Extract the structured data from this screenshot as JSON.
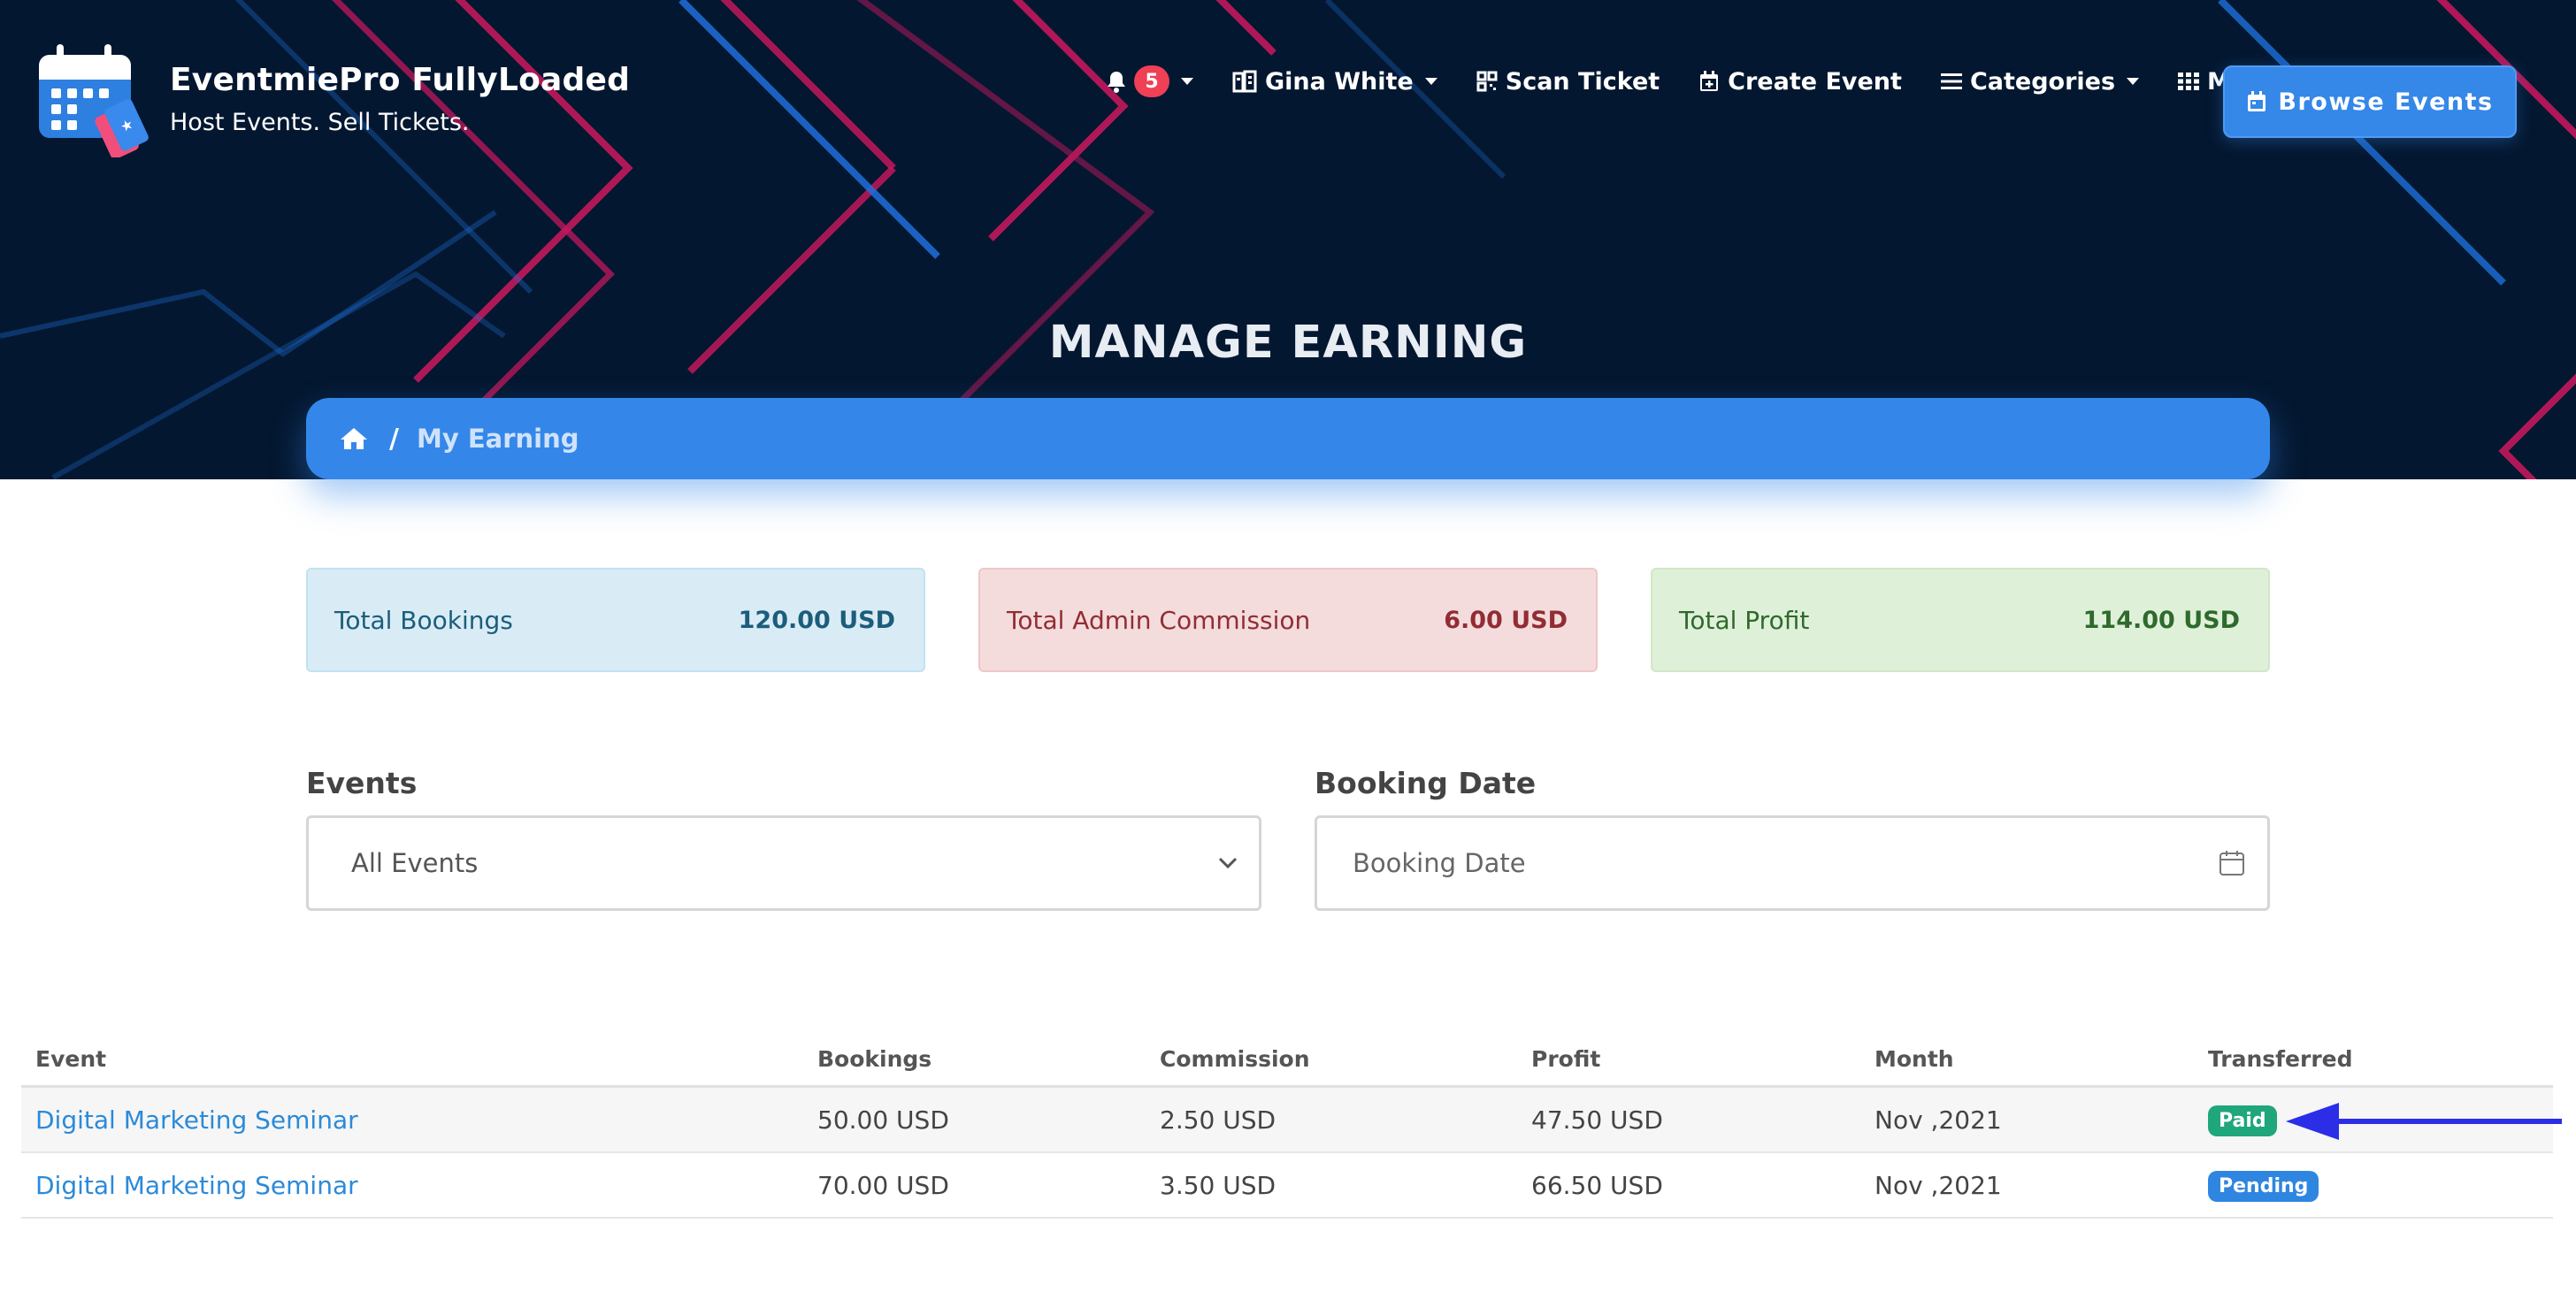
{
  "brand": {
    "name": "EventmiePro FullyLoaded",
    "tagline": "Host Events. Sell Tickets."
  },
  "nav": {
    "notifications_count": "5",
    "user_name": "Gina White",
    "scan_ticket": "Scan Ticket",
    "create_event": "Create Event",
    "categories": "Categories",
    "more": "More",
    "browse_events": "Browse Events"
  },
  "page": {
    "title": "MANAGE EARNING",
    "breadcrumb_current": "My Earning"
  },
  "stats": {
    "total_bookings_label": "Total Bookings",
    "total_bookings_value": "120.00 USD",
    "total_admin_commission_label": "Total Admin Commission",
    "total_admin_commission_value": "6.00 USD",
    "total_profit_label": "Total Profit",
    "total_profit_value": "114.00 USD"
  },
  "filters": {
    "events_label": "Events",
    "events_selected": "All Events",
    "booking_date_label": "Booking Date",
    "booking_date_placeholder": "Booking Date"
  },
  "table": {
    "headers": [
      "Event",
      "Bookings",
      "Commission",
      "Profit",
      "Month",
      "Transferred"
    ],
    "rows": [
      {
        "event": "Digital Marketing Seminar",
        "bookings": "50.00 USD",
        "commission": "2.50 USD",
        "profit": "47.50 USD",
        "month": "Nov ,2021",
        "transferred": "Paid"
      },
      {
        "event": "Digital Marketing Seminar",
        "bookings": "70.00 USD",
        "commission": "3.50 USD",
        "profit": "66.50 USD",
        "month": "Nov ,2021",
        "transferred": "Pending"
      }
    ]
  },
  "colors": {
    "hero_bg": "#041730",
    "accent_blue": "#3487e9",
    "paid_green": "#1fa67a",
    "pending_blue": "#2f86e0",
    "annotation_arrow": "#2b2ee6"
  }
}
